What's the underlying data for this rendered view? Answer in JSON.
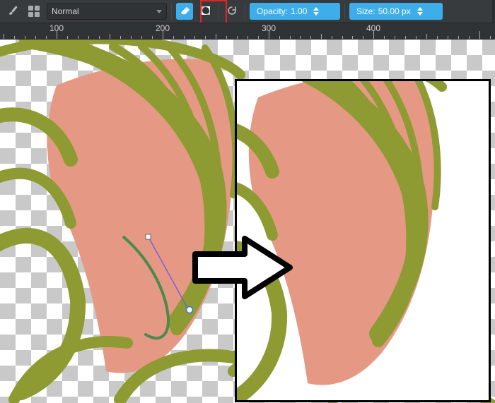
{
  "toolbar": {
    "blend_mode": "Normal",
    "opacity": {
      "label": "Opacity:",
      "value": "1.00"
    },
    "size": {
      "label": "Size:",
      "value": "50.00 px"
    }
  },
  "ruler": {
    "majors": [
      {
        "pos": 80,
        "label": "100"
      },
      {
        "pos": 230,
        "label": "200"
      },
      {
        "pos": 380,
        "label": "300"
      },
      {
        "pos": 528,
        "label": "400"
      }
    ]
  },
  "icons": {
    "brush": "brush-icon",
    "grid": "brush-preset-grid-icon",
    "eraser": "eraser-icon",
    "alpha": "preserve-alpha-icon",
    "reload": "reload-icon"
  }
}
